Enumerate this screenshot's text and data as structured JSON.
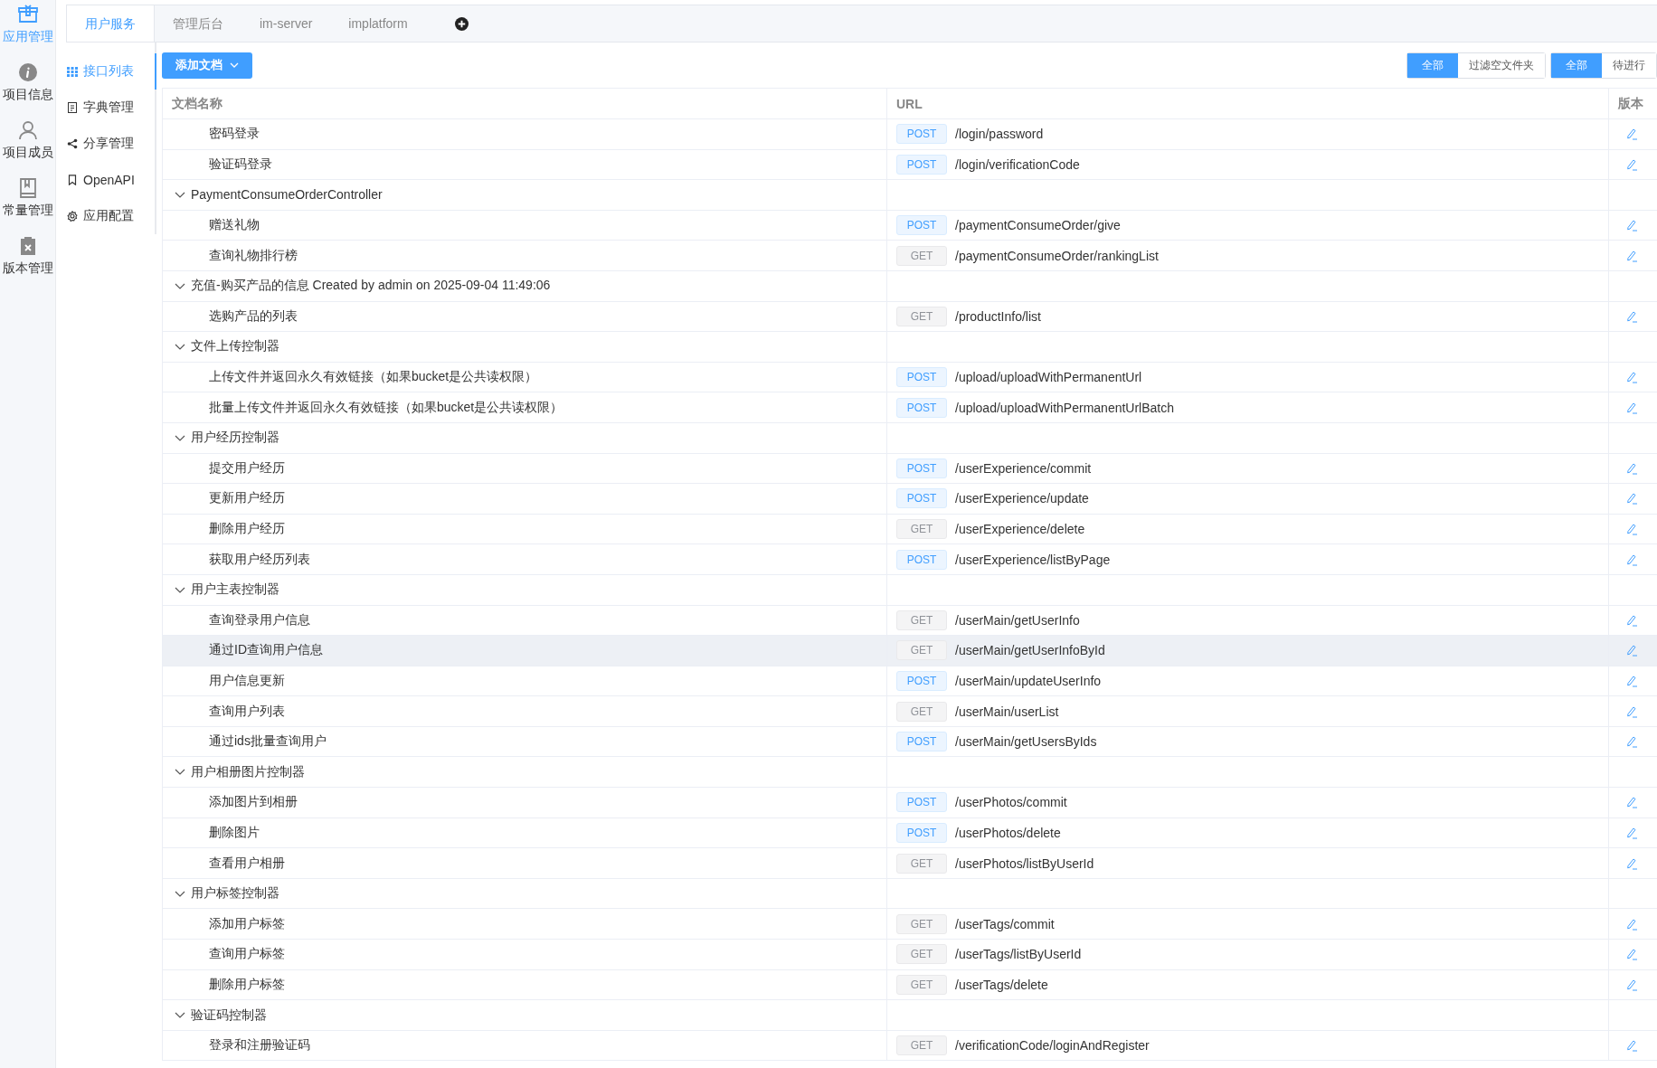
{
  "rail": [
    {
      "label": "应用管理",
      "selected": true
    },
    {
      "label": "项目信息",
      "selected": false
    },
    {
      "label": "项目成员",
      "selected": false
    },
    {
      "label": "常量管理",
      "selected": false
    },
    {
      "label": "版本管理",
      "selected": false
    }
  ],
  "tabs": [
    {
      "label": "用户服务",
      "selected": true
    },
    {
      "label": "管理后台",
      "selected": false
    },
    {
      "label": "im-server",
      "selected": false
    },
    {
      "label": "implatform",
      "selected": false
    }
  ],
  "subnav": [
    {
      "label": "接口列表",
      "selected": true
    },
    {
      "label": "字典管理",
      "selected": false
    },
    {
      "label": "分享管理",
      "selected": false
    },
    {
      "label": "OpenAPI",
      "selected": false
    },
    {
      "label": "应用配置",
      "selected": false
    }
  ],
  "add_button": "添加文档",
  "filters": [
    [
      {
        "label": "全部",
        "selected": true
      },
      {
        "label": "过滤空文件夹",
        "selected": false
      }
    ],
    [
      {
        "label": "全部",
        "selected": true
      },
      {
        "label": "待进行",
        "selected": false
      }
    ]
  ],
  "table": {
    "columns": [
      "文档名称",
      "URL",
      "版本"
    ],
    "rows": [
      {
        "kind": "item",
        "name": "密码登录",
        "method": "POST",
        "url": "/login/password",
        "hovered": false
      },
      {
        "kind": "item",
        "name": "验证码登录",
        "method": "POST",
        "url": "/login/verificationCode",
        "hovered": false
      },
      {
        "kind": "group",
        "name": "PaymentConsumeOrderController",
        "expanded": true
      },
      {
        "kind": "item",
        "name": "赠送礼物",
        "method": "POST",
        "url": "/paymentConsumeOrder/give",
        "hovered": false
      },
      {
        "kind": "item",
        "name": "查询礼物排行榜",
        "method": "GET",
        "url": "/paymentConsumeOrder/rankingList",
        "hovered": false
      },
      {
        "kind": "group",
        "name": "充值-购买产品的信息 Created by admin on 2025-09-04 11:49:06",
        "expanded": true
      },
      {
        "kind": "item",
        "name": "选购产品的列表",
        "method": "GET",
        "url": "/productInfo/list",
        "hovered": false
      },
      {
        "kind": "group",
        "name": "文件上传控制器",
        "expanded": true
      },
      {
        "kind": "item",
        "name": "上传文件并返回永久有效链接（如果bucket是公共读权限）",
        "method": "POST",
        "url": "/upload/uploadWithPermanentUrl",
        "hovered": false
      },
      {
        "kind": "item",
        "name": "批量上传文件并返回永久有效链接（如果bucket是公共读权限）",
        "method": "POST",
        "url": "/upload/uploadWithPermanentUrlBatch",
        "hovered": false
      },
      {
        "kind": "group",
        "name": "用户经历控制器",
        "expanded": true
      },
      {
        "kind": "item",
        "name": "提交用户经历",
        "method": "POST",
        "url": "/userExperience/commit",
        "hovered": false
      },
      {
        "kind": "item",
        "name": "更新用户经历",
        "method": "POST",
        "url": "/userExperience/update",
        "hovered": false
      },
      {
        "kind": "item",
        "name": "删除用户经历",
        "method": "GET",
        "url": "/userExperience/delete",
        "hovered": false
      },
      {
        "kind": "item",
        "name": "获取用户经历列表",
        "method": "POST",
        "url": "/userExperience/listByPage",
        "hovered": false
      },
      {
        "kind": "group",
        "name": "用户主表控制器",
        "expanded": true
      },
      {
        "kind": "item",
        "name": "查询登录用户信息",
        "method": "GET",
        "url": "/userMain/getUserInfo",
        "hovered": false
      },
      {
        "kind": "item",
        "name": "通过ID查询用户信息",
        "method": "GET",
        "url": "/userMain/getUserInfoById",
        "hovered": true
      },
      {
        "kind": "item",
        "name": "用户信息更新",
        "method": "POST",
        "url": "/userMain/updateUserInfo",
        "hovered": false
      },
      {
        "kind": "item",
        "name": "查询用户列表",
        "method": "GET",
        "url": "/userMain/userList",
        "hovered": false
      },
      {
        "kind": "item",
        "name": "通过ids批量查询用户",
        "method": "POST",
        "url": "/userMain/getUsersByIds",
        "hovered": false
      },
      {
        "kind": "group",
        "name": "用户相册图片控制器",
        "expanded": true
      },
      {
        "kind": "item",
        "name": "添加图片到相册",
        "method": "POST",
        "url": "/userPhotos/commit",
        "hovered": false
      },
      {
        "kind": "item",
        "name": "删除图片",
        "method": "POST",
        "url": "/userPhotos/delete",
        "hovered": false
      },
      {
        "kind": "item",
        "name": "查看用户相册",
        "method": "GET",
        "url": "/userPhotos/listByUserId",
        "hovered": false
      },
      {
        "kind": "group",
        "name": "用户标签控制器",
        "expanded": true
      },
      {
        "kind": "item",
        "name": "添加用户标签",
        "method": "GET",
        "url": "/userTags/commit",
        "hovered": false
      },
      {
        "kind": "item",
        "name": "查询用户标签",
        "method": "GET",
        "url": "/userTags/listByUserId",
        "hovered": false
      },
      {
        "kind": "item",
        "name": "删除用户标签",
        "method": "GET",
        "url": "/userTags/delete",
        "hovered": false
      },
      {
        "kind": "group",
        "name": "验证码控制器",
        "expanded": true
      },
      {
        "kind": "item",
        "name": "登录和注册验证码",
        "method": "GET",
        "url": "/verificationCode/loginAndRegister",
        "hovered": false
      }
    ]
  }
}
